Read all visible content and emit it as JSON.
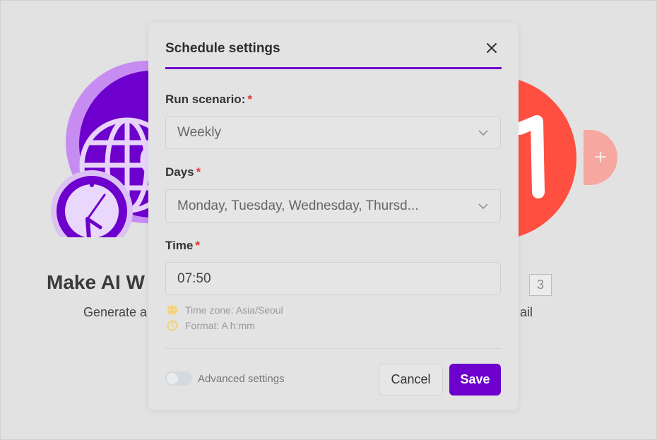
{
  "background": {
    "title": "Make AI W",
    "subtitle": "Generate a",
    "subtitle_right": "ail",
    "badge": "3",
    "plus": "+",
    "colors": {
      "left_module": "#6d00cc",
      "right_module": "#ff4f40"
    }
  },
  "dialog": {
    "title": "Schedule settings",
    "close_icon": "close-icon",
    "run_scenario": {
      "label": "Run scenario:",
      "value": "Weekly"
    },
    "days": {
      "label": "Days",
      "value": "Monday, Tuesday, Wednesday, Thursd..."
    },
    "time": {
      "label": "Time",
      "value": "07:50"
    },
    "required_mark": "*",
    "hints": {
      "timezone": "Time zone: Asia/Seoul",
      "format": "Format: A h:mm"
    },
    "advanced": {
      "label": "Advanced settings",
      "enabled": false
    },
    "buttons": {
      "cancel": "Cancel",
      "save": "Save"
    },
    "accent_color": "#6d00cc"
  }
}
